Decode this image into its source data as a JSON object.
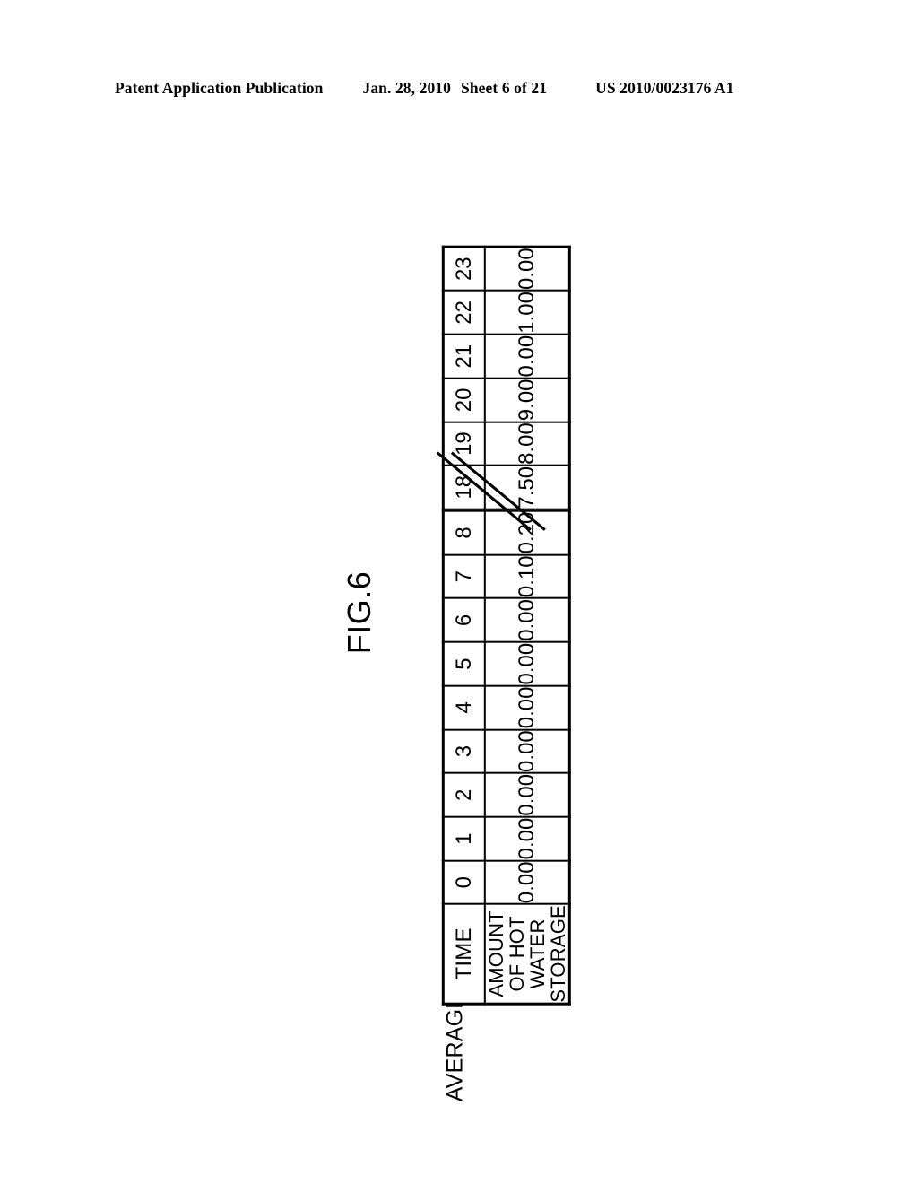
{
  "page_header": {
    "publication": "Patent Application Publication",
    "date": "Jan. 28, 2010",
    "sheet": "Sheet 6 of 21",
    "patent_number": "US 2010/0023176 A1"
  },
  "figure": {
    "label": "FIG.6",
    "title": "AVERAGE HOT WATER STORAGE AMOUNT CURVE",
    "break_symbol": "double-diagonal-break"
  },
  "table": {
    "row_headers": {
      "time": "TIME",
      "amount_line1": "AMOUNT OF HOT",
      "amount_line2": "WATER STORAGE"
    },
    "time": [
      "0",
      "1",
      "2",
      "3",
      "4",
      "5",
      "6",
      "7",
      "8",
      "18",
      "19",
      "20",
      "21",
      "22",
      "23"
    ],
    "amount": [
      "0.00",
      "0.00",
      "0.00",
      "0.00",
      "0.00",
      "0.00",
      "0.00",
      "0.10",
      "0.20",
      "7.50",
      "8.00",
      "9.00",
      "0.00",
      "1.00",
      "0.00"
    ],
    "break_after_index": 8
  },
  "chart_data": {
    "type": "table",
    "title": "AVERAGE HOT WATER STORAGE AMOUNT CURVE",
    "xlabel": "TIME",
    "ylabel": "AMOUNT OF HOT WATER STORAGE",
    "categories": [
      "0",
      "1",
      "2",
      "3",
      "4",
      "5",
      "6",
      "7",
      "8",
      "18",
      "19",
      "20",
      "21",
      "22",
      "23"
    ],
    "values": [
      0.0,
      0.0,
      0.0,
      0.0,
      0.0,
      0.0,
      0.0,
      0.1,
      0.2,
      7.5,
      8.0,
      9.0,
      0.0,
      1.0,
      0.0
    ],
    "note": "Hours 9 through 17 omitted; indicated by a double-diagonal break mark between hour 8 and hour 18."
  },
  "colors": {
    "ink": "#000000",
    "paper": "#ffffff"
  }
}
